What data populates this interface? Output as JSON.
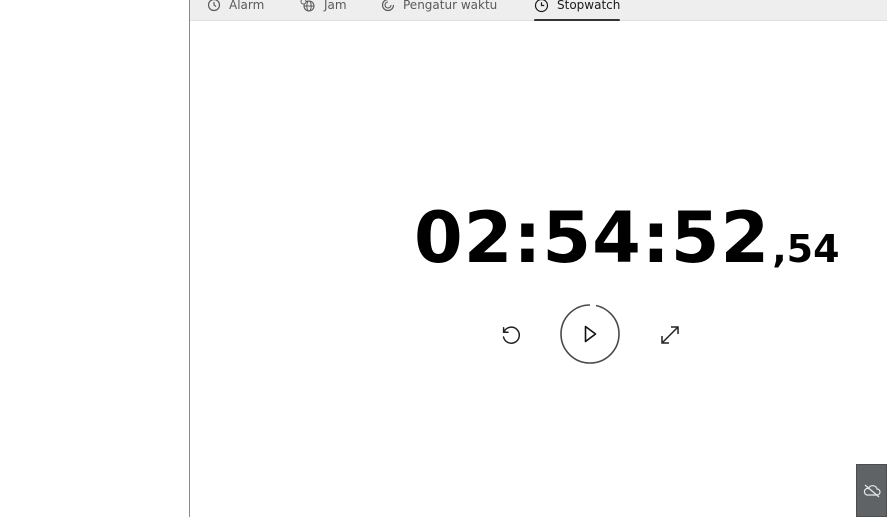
{
  "tabs": [
    {
      "label": "Alarm",
      "icon": "alarm-icon"
    },
    {
      "label": "Jam",
      "icon": "globe-clock-icon"
    },
    {
      "label": "Pengatur waktu",
      "icon": "timer-icon"
    },
    {
      "label": "Stopwatch",
      "icon": "stopwatch-icon",
      "active": true
    }
  ],
  "stopwatch": {
    "time_main": "02:54:52",
    "time_fraction": ",54",
    "buttons": {
      "reset_icon": "reset-icon",
      "play_icon": "play-icon",
      "expand_icon": "expand-icon"
    }
  },
  "tray": {
    "icon": "cloud-offline-icon"
  },
  "colors": {
    "tab_bar": "#eeeeee",
    "active_underline": "#333333",
    "text": "#000000",
    "tray_bg": "#5f6366"
  }
}
